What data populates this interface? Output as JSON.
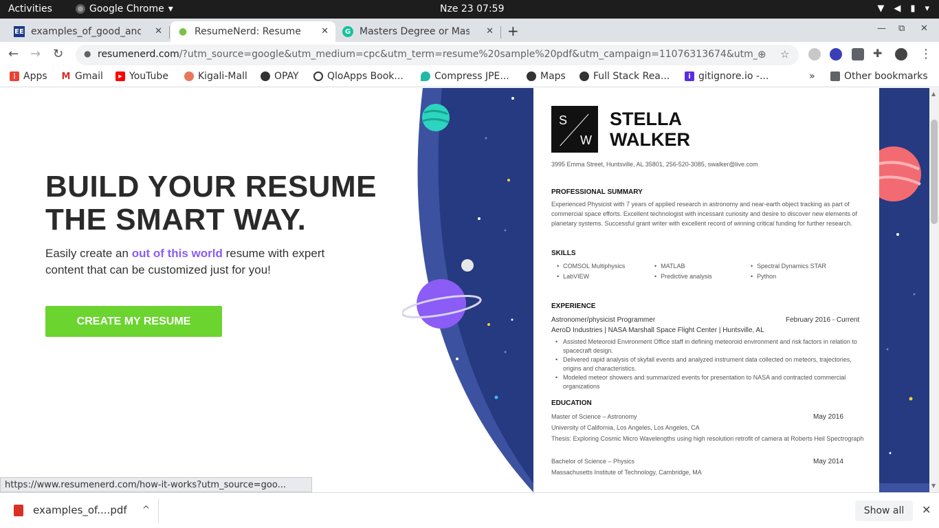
{
  "os": {
    "activities": "Activities",
    "app_name": "Google Chrome",
    "app_menu_arrow": "▾",
    "clock": "Nze 23  07:59",
    "tray_icons": [
      "wifi-icon",
      "volume-icon",
      "battery-icon",
      "power-menu-icon"
    ]
  },
  "tabs": [
    {
      "title": "examples_of_good_and_b",
      "favicon": "EE",
      "favicon_color": "#1a3a8a",
      "active": false
    },
    {
      "title": "ResumeNerd: Resume Buil",
      "favicon": "●",
      "favicon_color": "#7cc242",
      "active": true
    },
    {
      "title": "Masters Degree or Master",
      "favicon": "G",
      "favicon_color": "#15c39a",
      "active": false
    }
  ],
  "tab_close": "✕",
  "new_tab": "+",
  "window_controls": {
    "minimize": "—",
    "restore": "⧉",
    "close": "✕"
  },
  "toolbar": {
    "back": "←",
    "forward": "→",
    "reload": "↻",
    "lock": "🔒",
    "url_host": "resumenerd.com",
    "url_rest": "/?utm_source=google&utm_medium=cpc&utm_term=resume%20sample%20pdf&utm_campaign=11076313674&utm_source=goo...",
    "menu": "⋮"
  },
  "bookmarks": [
    {
      "label": "Apps",
      "icon": "apps-grid-icon",
      "color": "#e94235"
    },
    {
      "label": "Gmail",
      "icon": "gmail-icon",
      "color": "#d93025"
    },
    {
      "label": "YouTube",
      "icon": "youtube-icon",
      "color": "#ff0000"
    },
    {
      "label": "Kigali-Mall",
      "icon": "kigali-mall-icon",
      "color": "#e8775a"
    },
    {
      "label": "OPAY",
      "icon": "globe-icon",
      "color": "#333333"
    },
    {
      "label": "QloApps Book...",
      "icon": "qloapps-icon",
      "color": "#333333"
    },
    {
      "label": "Compress JPE...",
      "icon": "compress-icon",
      "color": "#22b8a6"
    },
    {
      "label": "Maps",
      "icon": "globe-icon",
      "color": "#333333"
    },
    {
      "label": "Full Stack Rea...",
      "icon": "globe-icon",
      "color": "#333333"
    },
    {
      "label": "gitignore.io -...",
      "icon": "gitignore-icon",
      "color": "#5b2ce0"
    }
  ],
  "bookmarks_overflow": "»",
  "other_bookmarks": "Other bookmarks",
  "hero": {
    "title_line1": "BUILD YOUR RESUME",
    "title_line2": "THE SMART WAY.",
    "sub_before": "Easily create an ",
    "sub_highlight": "out of this world",
    "sub_after": " resume with expert content that can be customized just for you!",
    "cta": "CREATE MY RESUME"
  },
  "resume": {
    "logo_s": "S",
    "logo_w": "W",
    "first_name": "STELLA",
    "last_name": "WALKER",
    "contact": "3995 Emma Street, Huntsville, AL 35801, 256-520-3085, swalker@live.com",
    "summary_heading": "PROFESSIONAL SUMMARY",
    "summary": "Experienced Physicist with 7 years of applied research in astronomy and near-earth object tracking as part of commercial space efforts. Excellent technologist with incessant curiosity and desire to discover new elements of planetary systems. Successful grant writer with excellent record of winning critical funding for further research.",
    "skills_heading": "SKILLS",
    "skills": [
      "COMSOL Multiphysics",
      "MATLAB",
      "Spectral Dynamics STAR",
      "LabVIEW",
      "Predictive analysis",
      "Python"
    ],
    "experience_heading": "EXPERIENCE",
    "job_title": "Astronomer/physicist Programmer",
    "job_dates": "February 2016 - Current",
    "job_company": "AeroD Industries | NASA Marshall Space Flight Center | Huntsville, AL",
    "job_bullets": [
      "Assisted Meteoroid Environment Office staff in defining meteoroid environment and risk factors in relation to spacecraft design.",
      "Delivered rapid analysis of skyfall events and analyzed instrument data collected on meteors, trajectories, origins and characteristics.",
      "Modeled meteor showers and summarized events for presentation to NASA and contracted commercial organizations"
    ],
    "education_heading": "EDUCATION",
    "edu1_degree": "Master of Science – Astronomy",
    "edu1_date": "May 2016",
    "edu1_school": "University of California, Los Angeles, Los Angeles, CA",
    "edu1_thesis": "Thesis: Exploring Cosmic Micro Wavelengths using high resolution retrofit of camera at Roberts Heil Spectrograph",
    "edu2_degree": "Bachelor of Science – Physics",
    "edu2_date": "May 2014",
    "edu2_school": "Massachusetts Institute of Technology, Cambridge, MA"
  },
  "status_url": "https://www.resumenerd.com/how-it-works?utm_source=goo...",
  "downloads": {
    "file": "examples_of....pdf",
    "chevron": "^",
    "show_all": "Show all",
    "close": "✕"
  },
  "colors": {
    "space": "#253a80",
    "space_edge": "#3c52a0",
    "cta": "#6bd42f",
    "highlight": "#8b5cf6"
  }
}
